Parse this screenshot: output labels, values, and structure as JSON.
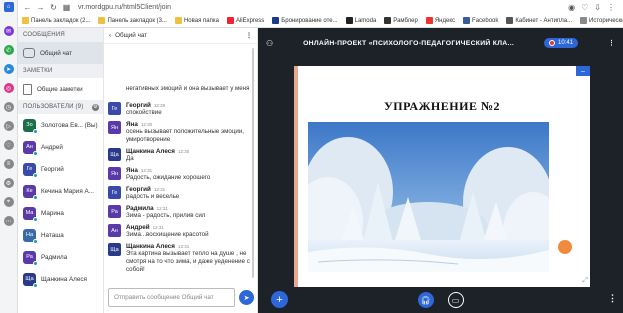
{
  "browser": {
    "url": "vr.mordgpu.ru/html5Client/join",
    "bookmarks": [
      {
        "label": "Панель закладок (2...",
        "color": "#f0c040"
      },
      {
        "label": "Панель закладок (3...",
        "color": "#f0c040"
      },
      {
        "label": "Новая папка",
        "color": "#f0c040"
      },
      {
        "label": "AliExpress",
        "color": "#e23"
      },
      {
        "label": "Бронирование оте...",
        "color": "#1a3a8a"
      },
      {
        "label": "Lamoda",
        "color": "#222"
      },
      {
        "label": "Рамблер",
        "color": "#333"
      },
      {
        "label": "Яндекс",
        "color": "#e33"
      },
      {
        "label": "Facebook",
        "color": "#3b5998"
      },
      {
        "label": "Кабинет - Антипла...",
        "color": "#555"
      },
      {
        "label": "Исторический ком...",
        "color": "#888"
      }
    ]
  },
  "sidebar": {
    "messages_header": "СООБЩЕНИЯ",
    "public_chat": "Общий чат",
    "notes_header": "ЗАМЕТКИ",
    "shared_notes": "Общие заметки",
    "users_header": "ПОЛЬЗОВАТЕЛИ (9)",
    "users": [
      {
        "initials": "Зо",
        "name": "Золотова Ев... (Вы)",
        "color": "#1a6e4a"
      },
      {
        "initials": "Ан",
        "name": "Андрей",
        "color": "#5a3aa8"
      },
      {
        "initials": "Ге",
        "name": "Георгий",
        "color": "#3a4aa8"
      },
      {
        "initials": "Ке",
        "name": "Кечина Мария А...",
        "color": "#5a3aa8"
      },
      {
        "initials": "Ма",
        "name": "Марина",
        "color": "#5a3aa8"
      },
      {
        "initials": "На",
        "name": "Наташа",
        "color": "#3a6aa8"
      },
      {
        "initials": "Ра",
        "name": "Радмила",
        "color": "#5a3aa8"
      },
      {
        "initials": "Ща",
        "name": "Щанкина Алеся",
        "color": "#2a3a8a"
      }
    ]
  },
  "chat": {
    "title": "Общий чат",
    "messages": [
      {
        "initials": "",
        "name": "",
        "time": "",
        "text": "негативных эмоций и она вызывает у меня",
        "color": "#3a4aa8"
      },
      {
        "initials": "Ге",
        "name": "Георгий",
        "time": "12:29",
        "text": "спокойствие",
        "color": "#3a4aa8"
      },
      {
        "initials": "Ян",
        "name": "Яна",
        "time": "12:30",
        "text": "осень вызывает положительные эмоции, умиротворение",
        "color": "#5a3aa8"
      },
      {
        "initials": "Ща",
        "name": "Щанкина Алеся",
        "time": "12:30",
        "text": "Да",
        "color": "#2a3a8a"
      },
      {
        "initials": "Ян",
        "name": "Яна",
        "time": "12:31",
        "text": "Радость, ожидание хорошего",
        "color": "#5a3aa8"
      },
      {
        "initials": "Ге",
        "name": "Георгий",
        "time": "12:31",
        "text": "радость и веселье",
        "color": "#3a4aa8"
      },
      {
        "initials": "Ра",
        "name": "Радмила",
        "time": "12:31",
        "text": "Зима - радость, прилив сил",
        "color": "#5a3aa8"
      },
      {
        "initials": "Ан",
        "name": "Андрей",
        "time": "12:31",
        "text": "Зима...восхищение красотой",
        "color": "#5a3aa8"
      },
      {
        "initials": "Ща",
        "name": "Щанкина Алеся",
        "time": "12:31",
        "text": "Эта картина вызывает тепло на душе , не смотря на то что зима, и даже уеденение с собой!",
        "color": "#2a3a8a"
      }
    ],
    "input_placeholder": "Отправить сообщение Общий чат"
  },
  "stage": {
    "title": "ОНЛАЙН-ПРОЕКТ «ПСИХОЛОГО-ПЕДАГОГИЧЕСКИЙ КЛА...",
    "timer": "10:41",
    "slide_title": "УПРАЖНЕНИЕ №2"
  },
  "colors": {
    "accent": "#2e67d8",
    "orange": "#f08a3c"
  }
}
